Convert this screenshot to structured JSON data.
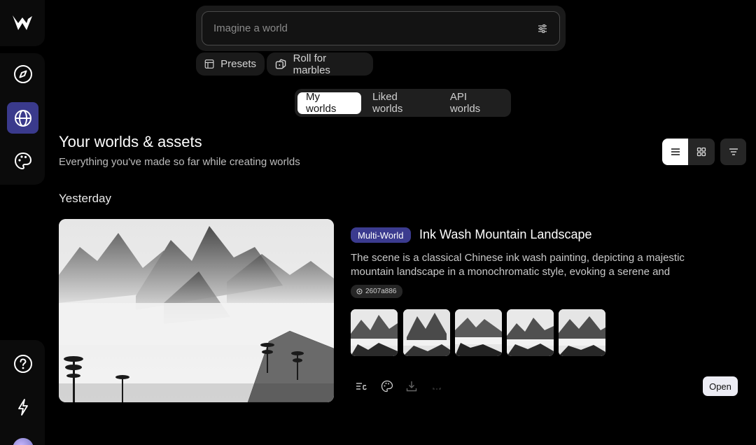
{
  "search": {
    "placeholder": "Imagine a world"
  },
  "chips": {
    "presets": "Presets",
    "roll": "Roll for marbles"
  },
  "tabs": [
    {
      "label": "My worlds",
      "active": true
    },
    {
      "label": "Liked worlds",
      "active": false
    },
    {
      "label": "API worlds",
      "active": false
    }
  ],
  "header": {
    "title": "Your worlds & assets",
    "subtitle": "Everything you've made so far while creating worlds"
  },
  "section": {
    "label": "Yesterday"
  },
  "world": {
    "badge": "Multi-World",
    "title": "Ink Wash Mountain Landscape",
    "description": "The scene is a classical Chinese ink wash painting, depicting a majestic mountain landscape in a monochromatic style, evoking a serene and timeless…",
    "hash": "2607a886",
    "open_label": "Open"
  },
  "colors": {
    "accent": "#3a3a8c",
    "background": "#000000",
    "panel": "#1a1a1a"
  }
}
